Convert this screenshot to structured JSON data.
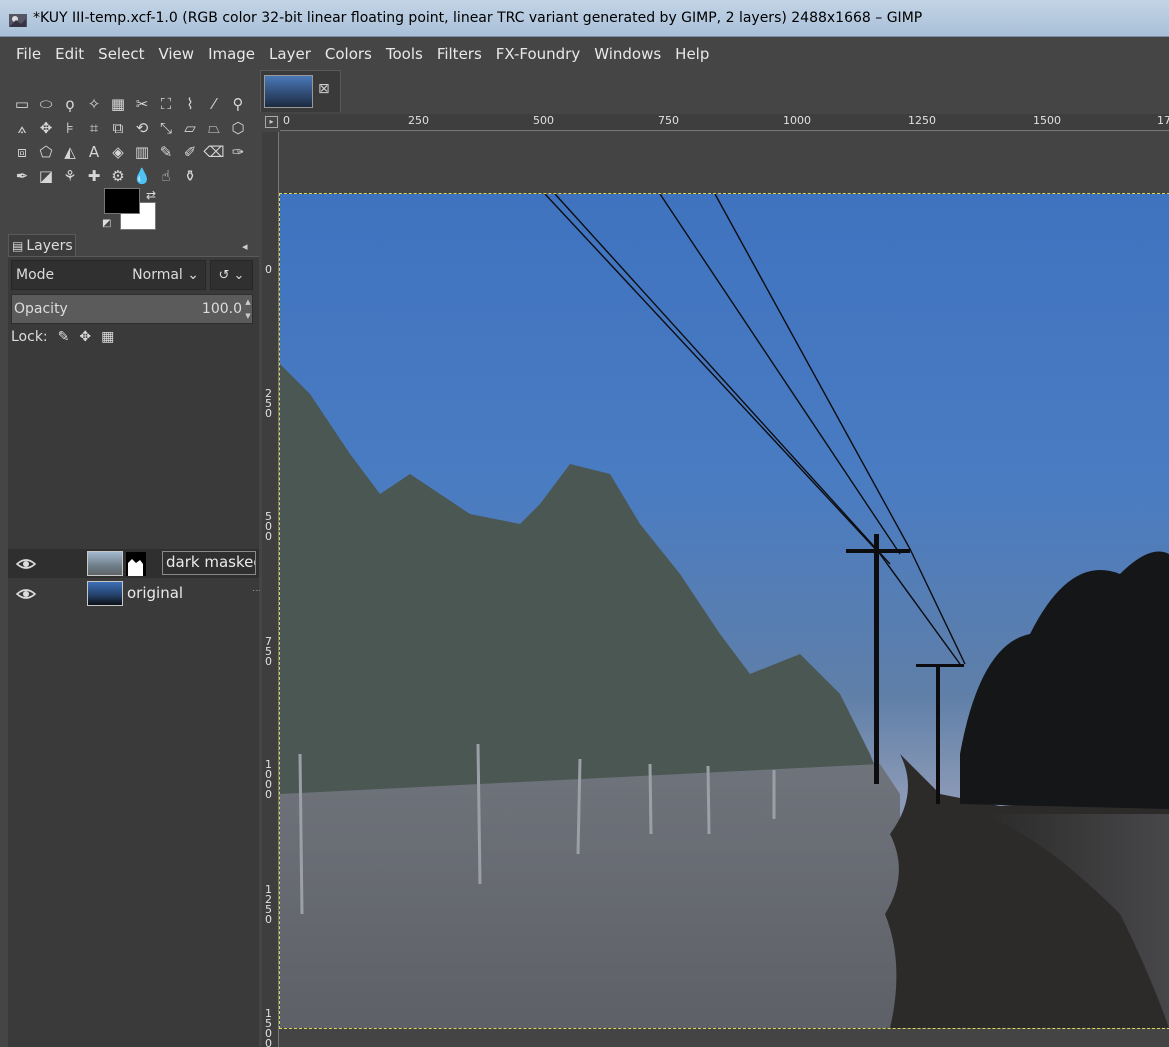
{
  "window": {
    "title": "*KUY III-temp.xcf-1.0 (RGB color 32-bit linear floating point, linear TRC variant generated by GIMP, 2 layers) 2488x1668 – GIMP"
  },
  "menu": [
    "File",
    "Edit",
    "Select",
    "View",
    "Image",
    "Layer",
    "Colors",
    "Tools",
    "Filters",
    "FX-Foundry",
    "Windows",
    "Help"
  ],
  "colors": {
    "foreground": "#000000",
    "background": "#ffffff",
    "selection_outline": "#d8d85a"
  },
  "layers_panel": {
    "tab_label": "Layers",
    "mode_label": "Mode",
    "mode_value": "Normal",
    "opacity_label": "Opacity",
    "opacity_value": "100.0",
    "lock_label": "Lock:",
    "layers": [
      {
        "name": "dark masked",
        "visible": true,
        "selected": true,
        "has_mask": true
      },
      {
        "name": "original",
        "visible": true,
        "selected": false,
        "has_mask": false
      }
    ]
  },
  "ruler": {
    "h_labels": [
      "0",
      "250",
      "500",
      "750",
      "1000",
      "1250",
      "1500",
      "17"
    ],
    "v_labels": [
      "0",
      "250",
      "500",
      "750",
      "1000",
      "1250",
      "1500"
    ]
  }
}
